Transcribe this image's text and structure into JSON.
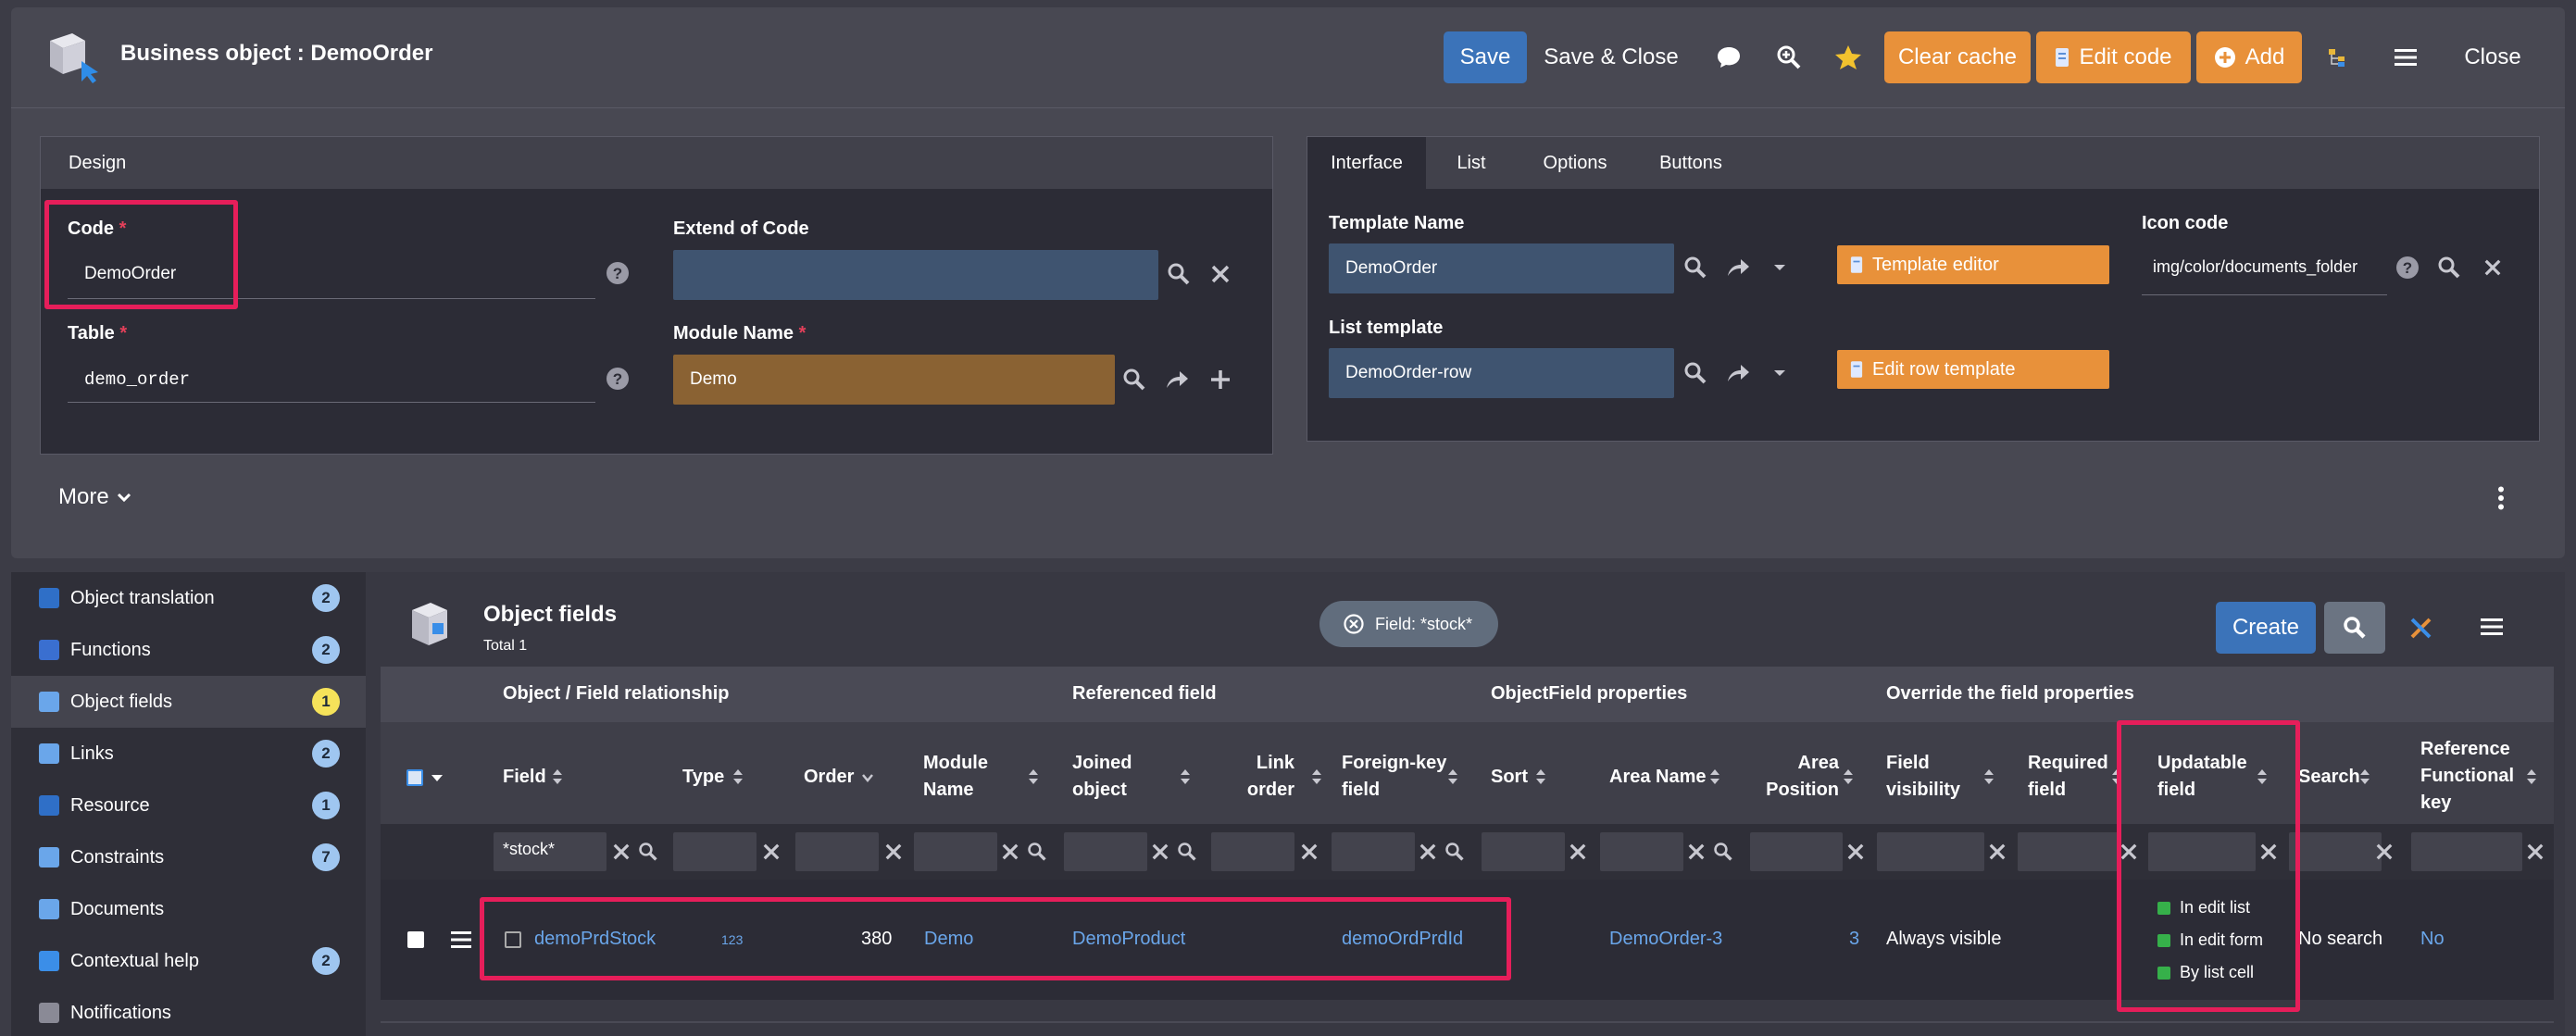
{
  "header": {
    "title": "Business object : DemoOrder",
    "buttons": {
      "save": "Save",
      "save_close": "Save & Close",
      "clear_cache": "Clear cache",
      "edit_code": "Edit code",
      "add": "Add",
      "close": "Close"
    }
  },
  "design": {
    "tab": "Design",
    "code_label": "Code",
    "code_value": "DemoOrder",
    "extend_label": "Extend of Code",
    "extend_value": "",
    "table_label": "Table",
    "table_value": "demo_order",
    "module_label": "Module Name",
    "module_value": "Demo",
    "required_mark": "*",
    "more": "More"
  },
  "interface": {
    "tabs": [
      "Interface",
      "List",
      "Options",
      "Buttons"
    ],
    "template_name_label": "Template Name",
    "template_name_value": "DemoOrder",
    "template_editor": "Template editor",
    "icon_code_label": "Icon code",
    "icon_code_value": "img/color/documents_folder",
    "list_template_label": "List template",
    "list_template_value": "DemoOrder-row",
    "edit_row_template": "Edit row template"
  },
  "sidebar": {
    "items": [
      {
        "label": "Object translation",
        "count": "2",
        "color": "#2f6fc7"
      },
      {
        "label": "Functions",
        "count": "2",
        "color": "#3a6fd0"
      },
      {
        "label": "Object fields",
        "count": "1",
        "color": "#6aa6ea"
      },
      {
        "label": "Links",
        "count": "2",
        "color": "#6aa6ea"
      },
      {
        "label": "Resource",
        "count": "1",
        "color": "#2f6fc7"
      },
      {
        "label": "Constraints",
        "count": "7",
        "color": "#6aa6ea"
      },
      {
        "label": "Documents",
        "count": "",
        "color": "#6aa6ea"
      },
      {
        "label": "Contextual help",
        "count": "2",
        "color": "#3b8ee8"
      },
      {
        "label": "Notifications",
        "count": "",
        "color": "#8a8a96"
      }
    ]
  },
  "object_fields": {
    "title": "Object fields",
    "total": "Total 1",
    "filter_chip": "Field: *stock*",
    "create": "Create",
    "groups": {
      "relationship": "Object / Field relationship",
      "referenced": "Referenced field",
      "properties": "ObjectField properties",
      "override": "Override the field properties"
    },
    "columns": {
      "field": "Field",
      "type": "Type",
      "order": "Order",
      "module_1": "Module",
      "module_2": "Name",
      "joined_1": "Joined",
      "joined_2": "object",
      "link_1": "Link",
      "link_2": "order",
      "fk_1": "Foreign-key",
      "fk_2": "field",
      "sort": "Sort",
      "area_name": "Area Name",
      "area_pos_1": "Area",
      "area_pos_2": "Position",
      "visibility_1": "Field",
      "visibility_2": "visibility",
      "required_1": "Required",
      "required_2": "field",
      "updatable_1": "Updatable",
      "updatable_2": "field",
      "search": "Search",
      "ref_1": "Reference",
      "ref_2": "Functional",
      "ref_3": "key"
    },
    "filter_field_value": "*stock*",
    "row": {
      "field": "demoPrdStock",
      "type": "123",
      "order": "380",
      "module": "Demo",
      "joined": "DemoProduct",
      "fk": "demoOrdPrdId",
      "area_name": "DemoOrder-3",
      "area_position": "3",
      "visibility": "Always visible",
      "updatable": [
        "In edit list",
        "In edit form",
        "By list cell"
      ],
      "search": "No search",
      "ref": "No"
    }
  }
}
